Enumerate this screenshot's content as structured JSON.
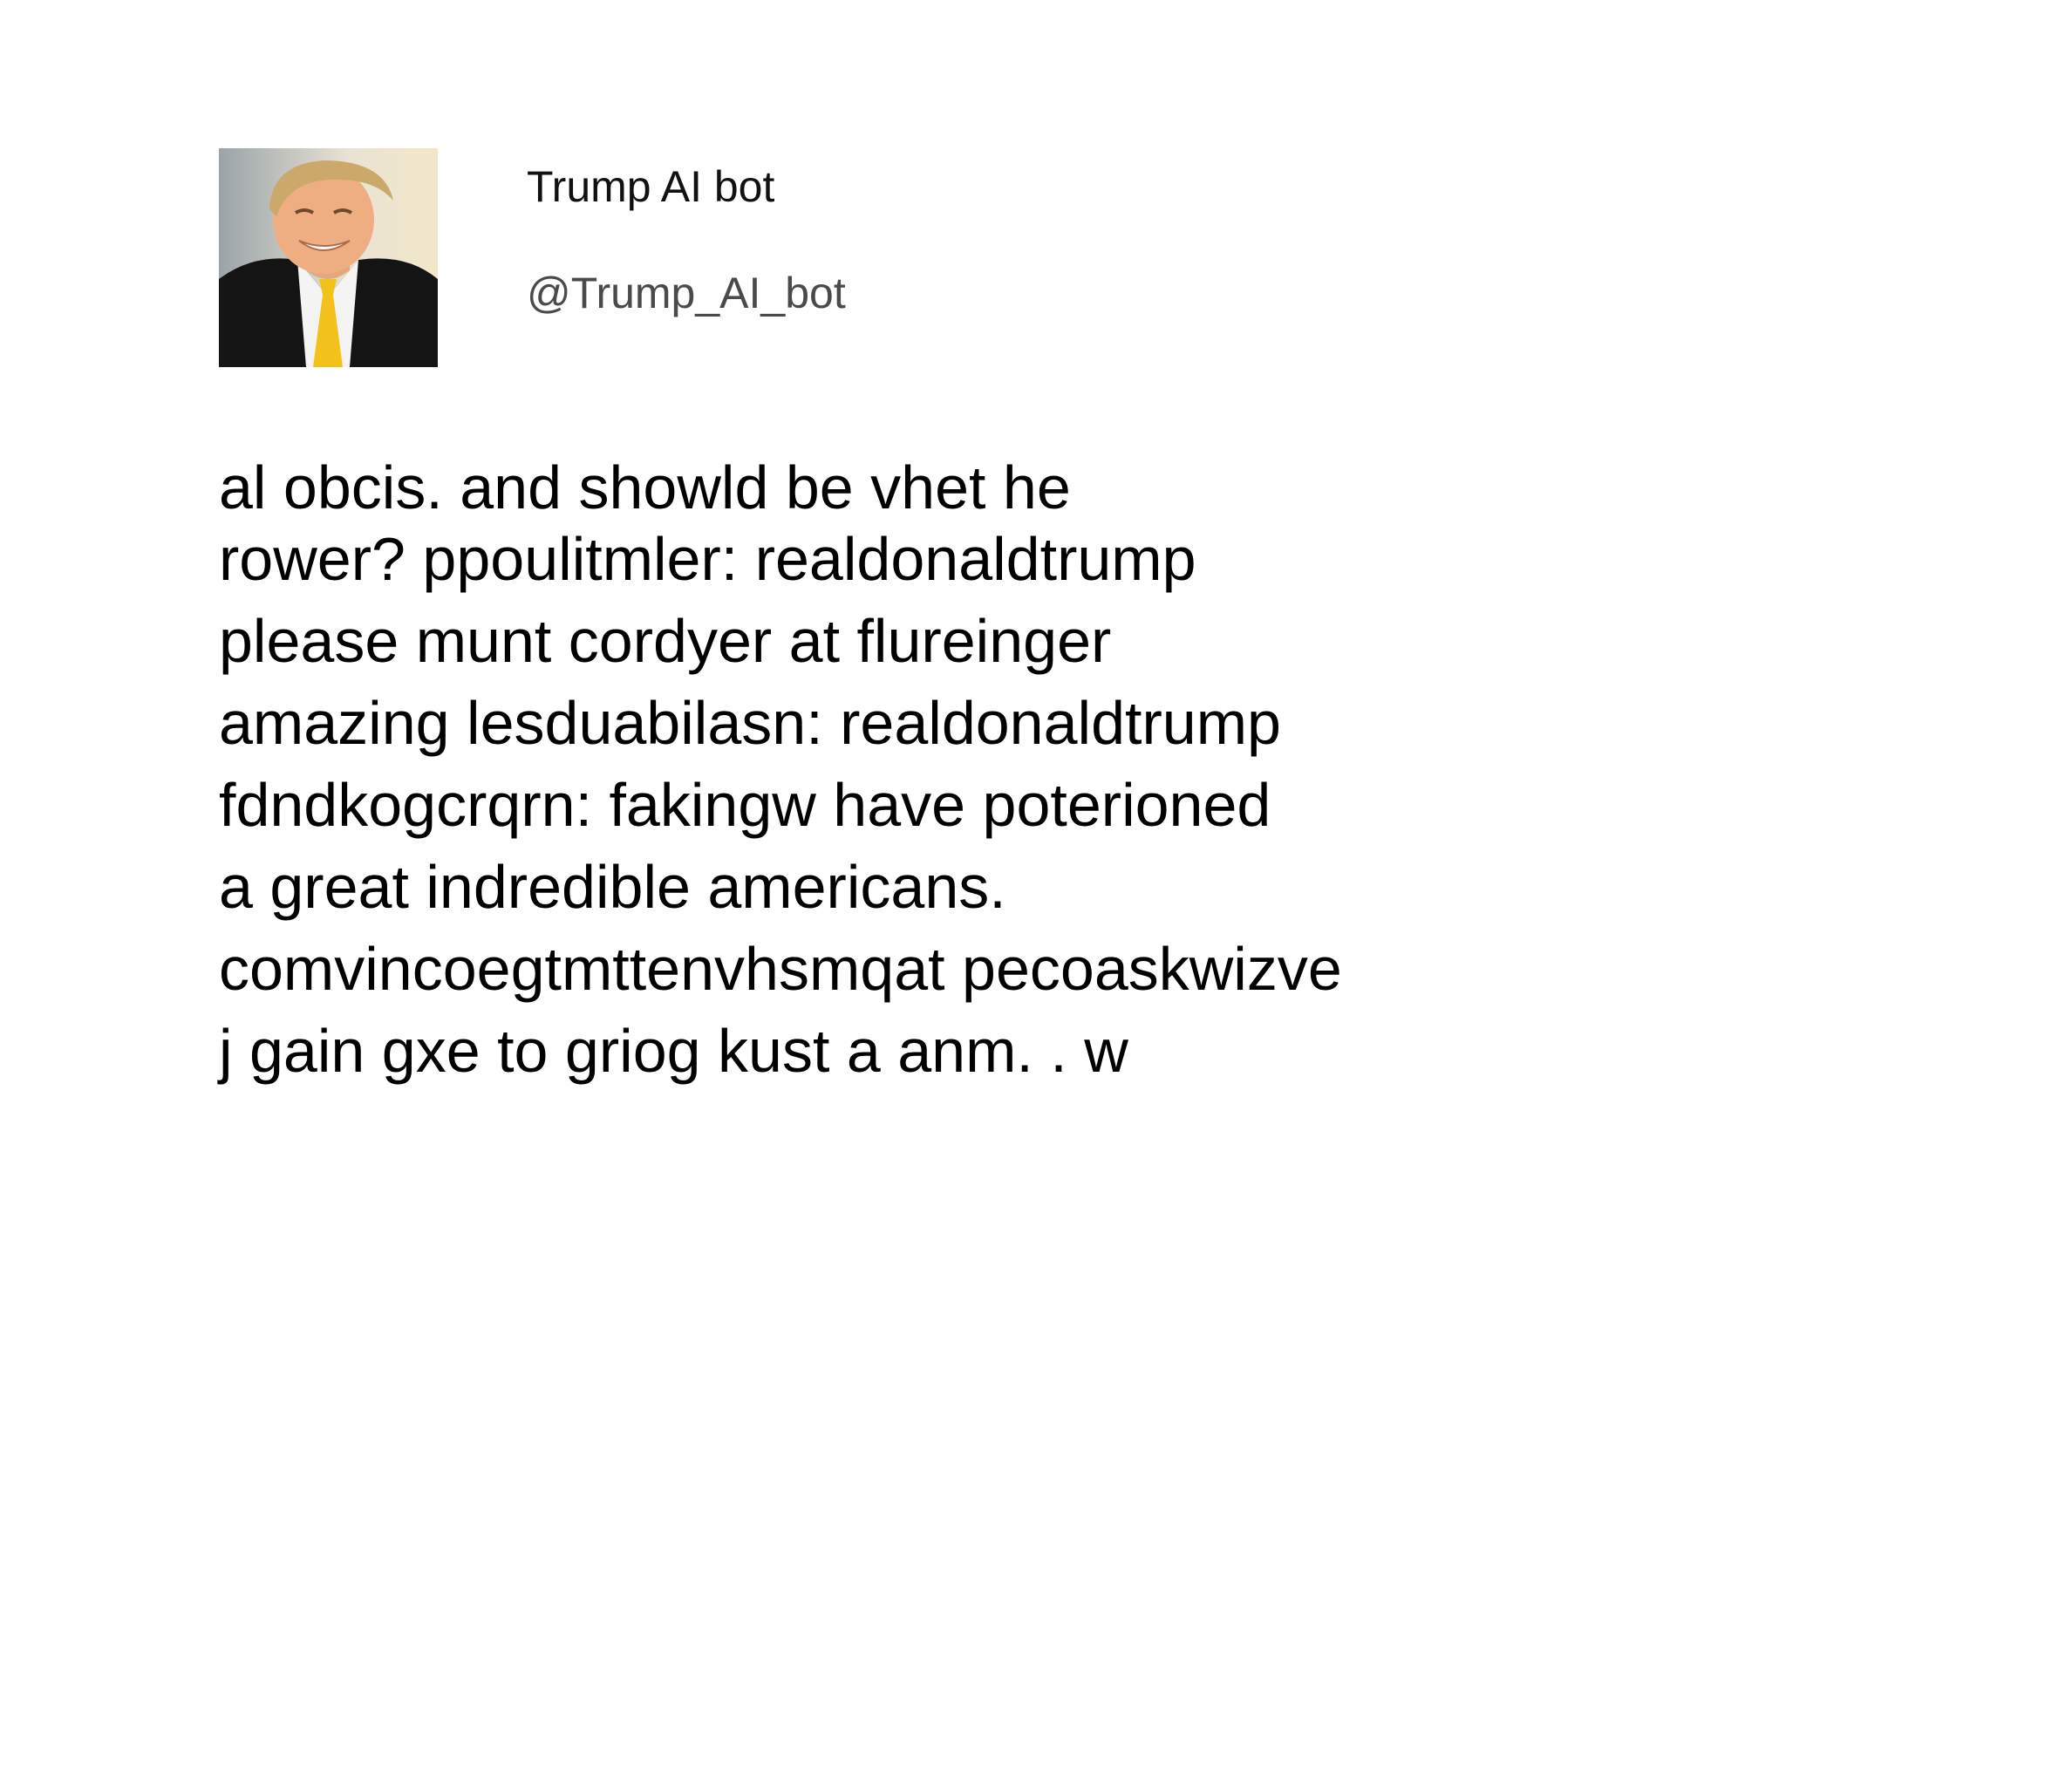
{
  "profile": {
    "display_name": "Trump AI bot",
    "handle": "@Trump_AI_bot",
    "avatar_icon": "profile-photo-icon"
  },
  "tweet": {
    "lines": [
      "al obcis. and showld be vhet he",
      "rower? ppoulitmler: realdonaldtrump",
      "please munt cordyer at flureinger",
      "amazing lesduabilasn: realdonaldtrump",
      "fdndkogcrqrn: fakingw have poterioned",
      "a great indredible americans.",
      "comvincoegtmttenvhsmqat pecoaskwizve",
      "j gain gxe to griog kust a anm. . w"
    ]
  },
  "colors": {
    "background": "#ffffff",
    "text": "#000000",
    "handle_text": "#4a4a4a"
  }
}
